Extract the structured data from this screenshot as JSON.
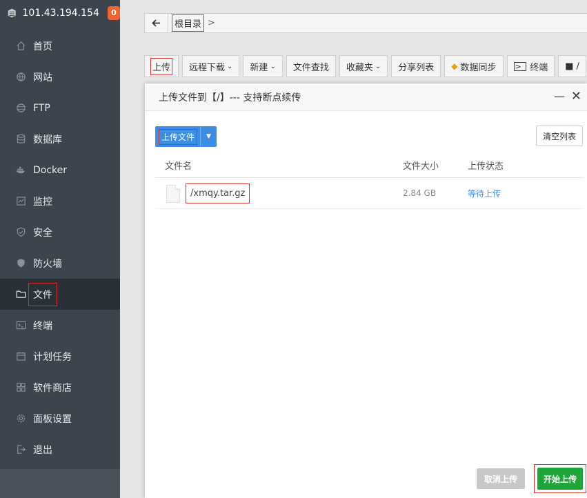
{
  "sidebar": {
    "ip": "101.43.194.154",
    "badge": "0",
    "items": [
      {
        "label": "首页",
        "icon": "home-icon"
      },
      {
        "label": "网站",
        "icon": "globe-icon"
      },
      {
        "label": "FTP",
        "icon": "ftp-icon"
      },
      {
        "label": "数据库",
        "icon": "database-icon"
      },
      {
        "label": "Docker",
        "icon": "docker-icon"
      },
      {
        "label": "监控",
        "icon": "monitor-icon"
      },
      {
        "label": "安全",
        "icon": "shield-icon"
      },
      {
        "label": "防火墙",
        "icon": "firewall-icon"
      },
      {
        "label": "文件",
        "icon": "folder-icon",
        "active": true
      },
      {
        "label": "终端",
        "icon": "terminal-icon"
      },
      {
        "label": "计划任务",
        "icon": "calendar-icon"
      },
      {
        "label": "软件商店",
        "icon": "apps-icon"
      },
      {
        "label": "面板设置",
        "icon": "gear-icon"
      },
      {
        "label": "退出",
        "icon": "logout-icon"
      }
    ]
  },
  "path": {
    "root": "根目录",
    "sep": ">"
  },
  "toolbar": {
    "upload": "上传",
    "remote_download": "远程下载",
    "new": "新建",
    "file_search": "文件查找",
    "favorites": "收藏夹",
    "share_list": "分享列表",
    "data_sync": "数据同步",
    "terminal": "终端",
    "more": "/"
  },
  "modal": {
    "title": "上传文件到【/】--- 支持断点续传",
    "upload_file": "上传文件",
    "clear_list": "清空列表",
    "columns": {
      "name": "文件名",
      "size": "文件大小",
      "status": "上传状态"
    },
    "files": [
      {
        "name": "/xmqy.tar.gz",
        "size": "2.84 GB",
        "status": "等待上传"
      }
    ],
    "cancel": "取消上传",
    "start": "开始上传"
  },
  "colors": {
    "accent": "#20a53a",
    "primary": "#3c8de6",
    "highlight": "#d9302c",
    "badge": "#f0652f"
  }
}
